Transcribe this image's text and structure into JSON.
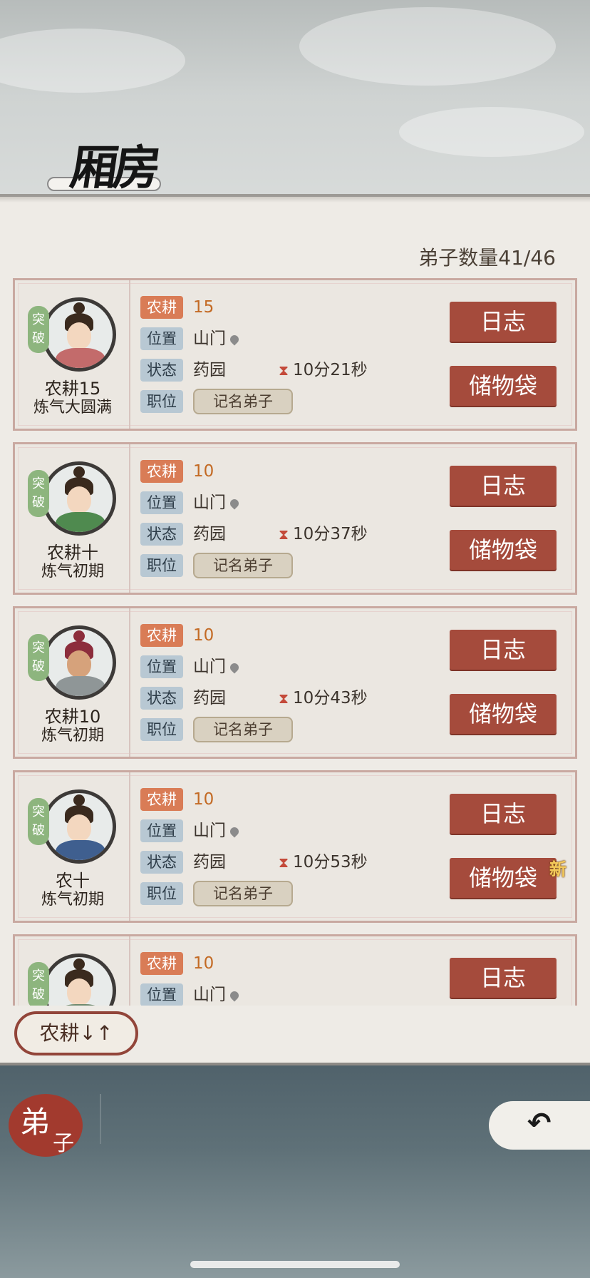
{
  "header": {
    "title": "厢房"
  },
  "count_label": "弟子数量41/46",
  "buttons": {
    "log": "日志",
    "bag": "储物袋",
    "new_mark": "新",
    "sort": "农耕↓↑"
  },
  "labels": {
    "farm": "农耕",
    "location": "位置",
    "status": "状态",
    "role": "职位",
    "break": "突破"
  },
  "disciples": [
    {
      "name": "农耕15",
      "realm": "炼气大圆满",
      "farm_level": "15",
      "location": "山门",
      "status": "药园",
      "timer": "10分21秒",
      "role": "记名弟子",
      "has_new": false
    },
    {
      "name": "农耕十",
      "realm": "炼气初期",
      "farm_level": "10",
      "location": "山门",
      "status": "药园",
      "timer": "10分37秒",
      "role": "记名弟子",
      "has_new": false
    },
    {
      "name": "农耕10",
      "realm": "炼气初期",
      "farm_level": "10",
      "location": "山门",
      "status": "药园",
      "timer": "10分43秒",
      "role": "记名弟子",
      "has_new": false
    },
    {
      "name": "农十",
      "realm": "炼气初期",
      "farm_level": "10",
      "location": "山门",
      "status": "药园",
      "timer": "10分53秒",
      "role": "记名弟子",
      "has_new": true
    },
    {
      "name": "",
      "realm": "",
      "farm_level": "10",
      "location": "山门",
      "status": "",
      "timer": "",
      "role": "",
      "has_new": false
    }
  ],
  "nav": {
    "tab_big": "弟",
    "tab_small": "子"
  },
  "colors": {
    "accent_red": "#a54b3c",
    "farm_tag": "#d97c56",
    "tag_blue": "#b8c8d3",
    "break_green": "#8db57e"
  }
}
